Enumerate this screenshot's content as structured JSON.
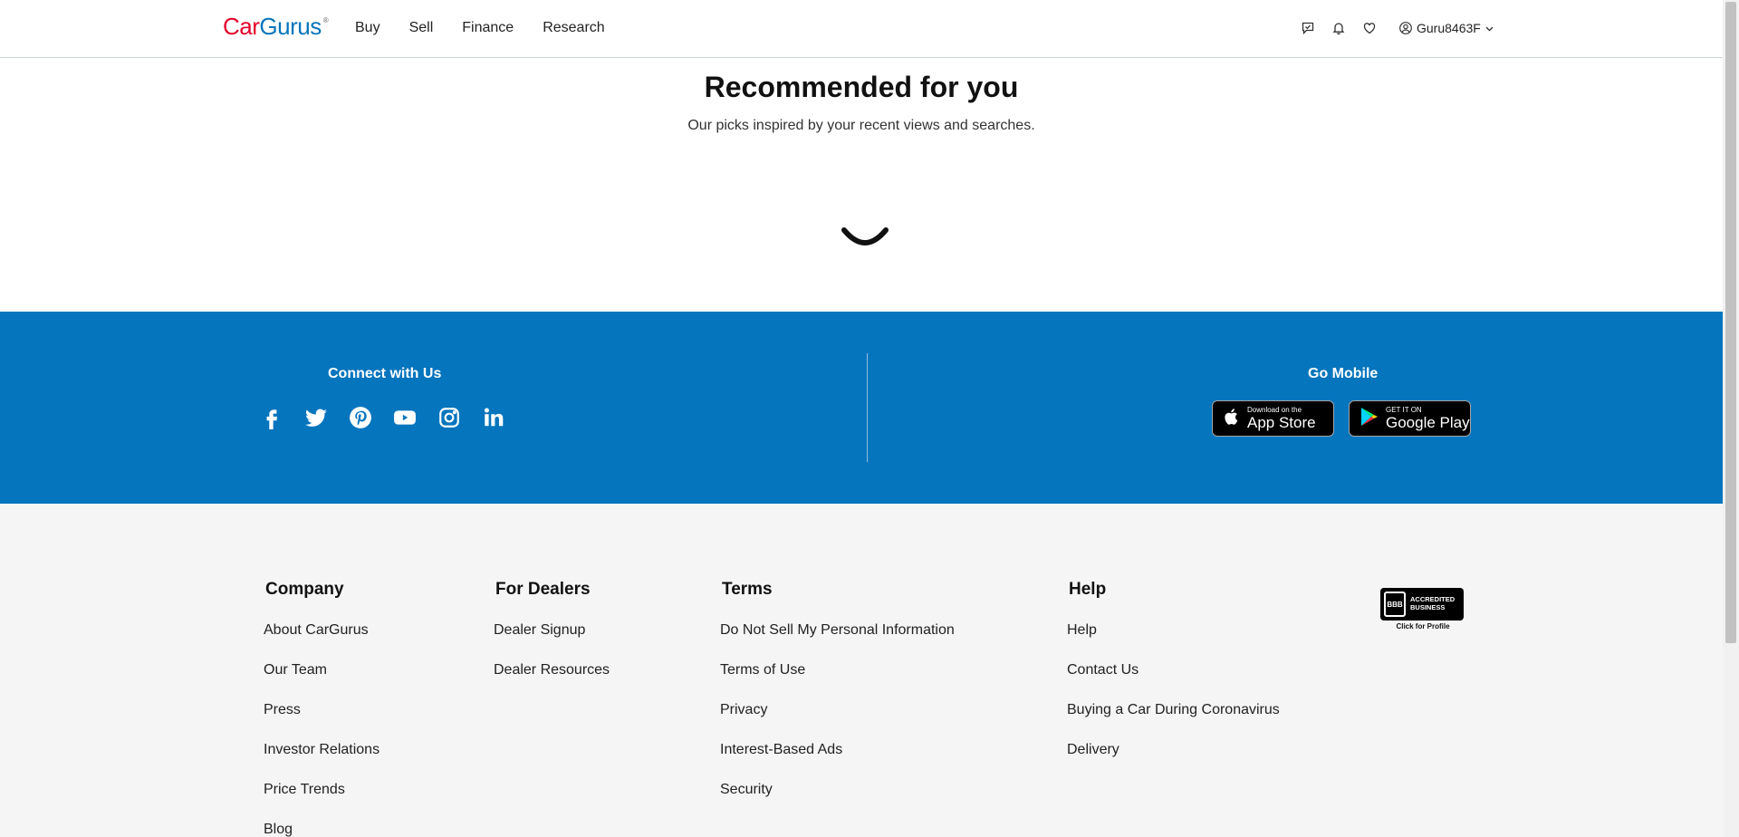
{
  "header": {
    "logo_car": "Car",
    "logo_gurus": "Gurus",
    "logo_mark": "®",
    "nav": [
      {
        "label": "Buy"
      },
      {
        "label": "Sell"
      },
      {
        "label": "Finance"
      },
      {
        "label": "Research"
      }
    ],
    "icons": [
      "messages-icon",
      "notifications-bell-icon",
      "favorites-heart-icon"
    ],
    "user": {
      "name": "Guru8463F",
      "icon": "user-circle-icon",
      "dropdown_icon": "chevron-down-icon"
    }
  },
  "recommended": {
    "title": "Recommended for you",
    "subtitle": "Our picks inspired by your recent views and searches.",
    "loading_icon": "loading-spinner-icon"
  },
  "connect": {
    "title": "Connect with Us",
    "social": [
      "facebook-icon",
      "twitter-icon",
      "pinterest-icon",
      "youtube-icon",
      "instagram-icon",
      "linkedin-icon"
    ]
  },
  "mobile": {
    "title": "Go Mobile",
    "app_store": {
      "small": "Download on the",
      "big": "App Store"
    },
    "google_play": {
      "small": "GET IT ON",
      "big": "Google Play"
    }
  },
  "footer": {
    "company": {
      "title": "Company",
      "items": [
        "About CarGurus",
        "Our Team",
        "Press",
        "Investor Relations",
        "Price Trends",
        "Blog"
      ]
    },
    "dealers": {
      "title": "For Dealers",
      "items": [
        "Dealer Signup",
        "Dealer Resources"
      ]
    },
    "terms": {
      "title": "Terms",
      "items": [
        "Do Not Sell My Personal Information",
        "Terms of Use",
        "Privacy",
        "Interest-Based Ads",
        "Security"
      ]
    },
    "help": {
      "title": "Help",
      "items": [
        "Help",
        "Contact Us",
        "Buying a Car During Coronavirus",
        "Delivery"
      ]
    },
    "bbb": {
      "seal": "BBB",
      "line1": "ACCREDITED",
      "line2": "BUSINESS",
      "caption": "Click for Profile"
    }
  },
  "colors": {
    "brand_red": "#e4002b",
    "brand_blue": "#0575b9",
    "band_blue": "#0575bd",
    "footer_bg": "#f4f5f4"
  }
}
